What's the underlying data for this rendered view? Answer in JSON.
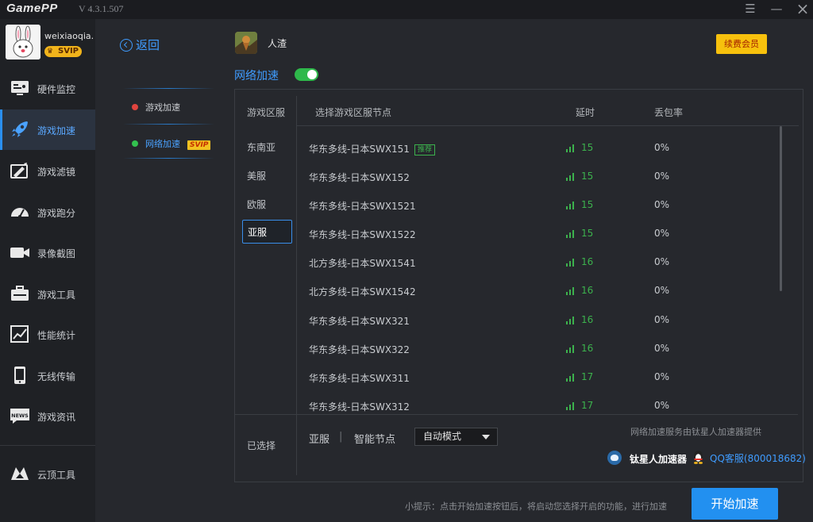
{
  "app": {
    "logo": "GamePP",
    "version": "V 4.3.1.507",
    "window_controls": [
      "menu-icon",
      "minimize-icon",
      "close-icon"
    ]
  },
  "user": {
    "name": "weixiaoqia...",
    "badge": "SVIP"
  },
  "sidebar": {
    "items": [
      {
        "label": "硬件监控",
        "icon": "hardware-monitor-icon",
        "active": false
      },
      {
        "label": "游戏加速",
        "icon": "rocket-icon",
        "active": true
      },
      {
        "label": "游戏滤镜",
        "icon": "filter-icon",
        "active": false
      },
      {
        "label": "游戏跑分",
        "icon": "speedometer-icon",
        "active": false
      },
      {
        "label": "录像截图",
        "icon": "video-camera-icon",
        "active": false
      },
      {
        "label": "游戏工具",
        "icon": "toolbox-icon",
        "active": false
      },
      {
        "label": "性能统计",
        "icon": "performance-chart-icon",
        "active": false
      },
      {
        "label": "无线传输",
        "icon": "phone-icon",
        "active": false
      },
      {
        "label": "游戏资讯",
        "icon": "news-icon",
        "active": false
      }
    ],
    "bottom_item": {
      "label": "云顶工具",
      "icon": "cloud-top-icon"
    }
  },
  "subnav": {
    "back_label": "返回",
    "items": [
      {
        "label": "游戏加速",
        "dot_color": "#e0443e",
        "active": false
      },
      {
        "label": "网络加速",
        "dot_color": "#33c14f",
        "active": true,
        "tag": "SVIP"
      }
    ]
  },
  "game": {
    "name": "人渣",
    "renew_label": "续费会员"
  },
  "network": {
    "label": "网络加速",
    "enabled": true
  },
  "panel": {
    "region_header": "游戏区服",
    "regions": [
      {
        "label": "东南亚",
        "active": false
      },
      {
        "label": "美服",
        "active": false
      },
      {
        "label": "欧服",
        "active": false
      },
      {
        "label": "亚服",
        "active": true
      }
    ],
    "columns": {
      "node": "选择游戏区服节点",
      "latency": "延时",
      "loss": "丢包率"
    },
    "rows": [
      {
        "node": "华东多线-日本SWX151",
        "badge": "推荐",
        "latency": "15",
        "loss": "0%"
      },
      {
        "node": "华东多线-日本SWX152",
        "badge": "",
        "latency": "15",
        "loss": "0%"
      },
      {
        "node": "华东多线-日本SWX1521",
        "badge": "",
        "latency": "15",
        "loss": "0%"
      },
      {
        "node": "华东多线-日本SWX1522",
        "badge": "",
        "latency": "15",
        "loss": "0%"
      },
      {
        "node": "北方多线-日本SWX1541",
        "badge": "",
        "latency": "16",
        "loss": "0%"
      },
      {
        "node": "北方多线-日本SWX1542",
        "badge": "",
        "latency": "16",
        "loss": "0%"
      },
      {
        "node": "华东多线-日本SWX321",
        "badge": "",
        "latency": "16",
        "loss": "0%"
      },
      {
        "node": "华东多线-日本SWX322",
        "badge": "",
        "latency": "16",
        "loss": "0%"
      },
      {
        "node": "华东多线-日本SWX311",
        "badge": "",
        "latency": "17",
        "loss": "0%"
      },
      {
        "node": "华东多线-日本SWX312",
        "badge": "",
        "latency": "17",
        "loss": "0%"
      }
    ],
    "selected_label": "已选择",
    "selected_region": "亚服",
    "separator": "|",
    "selected_node": "智能节点",
    "mode": "自动模式",
    "provider_text": "网络加速服务由钛星人加速器提供",
    "provider_name": "钛星人加速器",
    "qq_service": "QQ客服(800018682)"
  },
  "footer": {
    "tip": "小提示：点击开始加速按钮后，将启动您选择开启的功能，进行加速",
    "start_label": "开始加速"
  },
  "colors": {
    "accent": "#2290f0",
    "latency_green": "#3cb24d",
    "vip_gold": "#f7c10d"
  }
}
